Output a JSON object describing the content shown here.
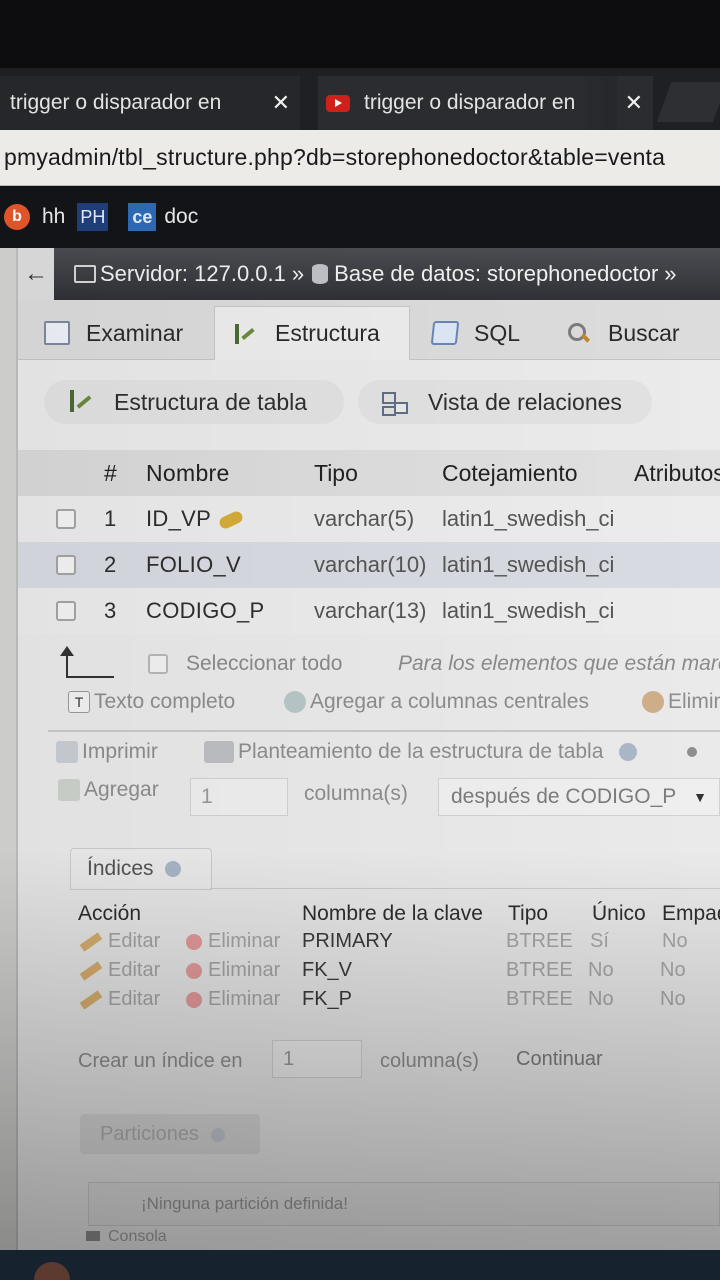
{
  "browser": {
    "tabs": [
      {
        "title": "trigger o disparador en"
      },
      {
        "title": "trigger o disparador en"
      }
    ],
    "close_glyph": "✕",
    "url": "pmyadmin/tbl_structure.php?db=storephonedoctor&table=venta",
    "bookmarks": [
      {
        "icon": "b",
        "label": "hh"
      },
      {
        "icon": "PH",
        "label": ""
      },
      {
        "icon": "ce",
        "label": "doc"
      }
    ]
  },
  "breadcrumb": {
    "back": "←",
    "server": "Servidor: 127.0.0.1",
    "sep": "»",
    "database": "Base de datos: storephonedoctor",
    "sep2": "»"
  },
  "menu_tabs": [
    "Examinar",
    "Estructura",
    "SQL",
    "Buscar"
  ],
  "sub_tabs": [
    "Estructura de tabla",
    "Vista de relaciones"
  ],
  "table": {
    "headers": [
      "#",
      "Nombre",
      "Tipo",
      "Cotejamiento",
      "Atributos"
    ],
    "rows": [
      {
        "num": "1",
        "name": "ID_VP",
        "type": "varchar(5)",
        "collation": "latin1_swedish_ci"
      },
      {
        "num": "2",
        "name": "FOLIO_V",
        "type": "varchar(10)",
        "collation": "latin1_swedish_ci"
      },
      {
        "num": "3",
        "name": "CODIGO_P",
        "type": "varchar(13)",
        "collation": "latin1_swedish_ci"
      }
    ]
  },
  "selection": {
    "select_all": "Seleccionar todo",
    "note": "Para los elementos que están marcados:"
  },
  "row_actions": {
    "full_text": "Texto completo",
    "add_central": "Agregar a columnas centrales",
    "delete": "Eliminar"
  },
  "print_actions": {
    "print": "Imprimir",
    "propose": "Planteamiento de la estructura de tabla"
  },
  "add_columns": {
    "label": "Agregar",
    "count": "1",
    "unit": "columna(s)",
    "position": "después de CODIGO_P"
  },
  "indices": {
    "title": "Índices",
    "headers": [
      "Acción",
      "Nombre de la clave",
      "Tipo",
      "Único",
      "Empaquetado"
    ],
    "edit": "Editar",
    "delete": "Eliminar",
    "rows": [
      {
        "key": "PRIMARY",
        "type": "BTREE",
        "unique": "Sí",
        "packed": "No"
      },
      {
        "key": "FK_V",
        "type": "BTREE",
        "unique": "No",
        "packed": "No"
      },
      {
        "key": "FK_P",
        "type": "BTREE",
        "unique": "No",
        "packed": "No"
      }
    ]
  },
  "create_index": {
    "label": "Crear un índice en",
    "count": "1",
    "unit": "columna(s)",
    "go": "Continuar"
  },
  "partitions": {
    "title": "Particiones",
    "note": "¡Ninguna partición definida!"
  },
  "console": "Consola",
  "colors": {
    "tab_bg": "#1f2023",
    "breadcrumb": "#3a3c41",
    "page_bg": "#eaeaea",
    "row_highlight": "#d8dbe2",
    "key_icon": "#d6ad3a",
    "youtube_red": "#d0201b"
  },
  "icons": {
    "tab_favicon": "youtube-icon",
    "bookmark_blogger": "blogger-icon",
    "primary_key": "key-icon"
  }
}
